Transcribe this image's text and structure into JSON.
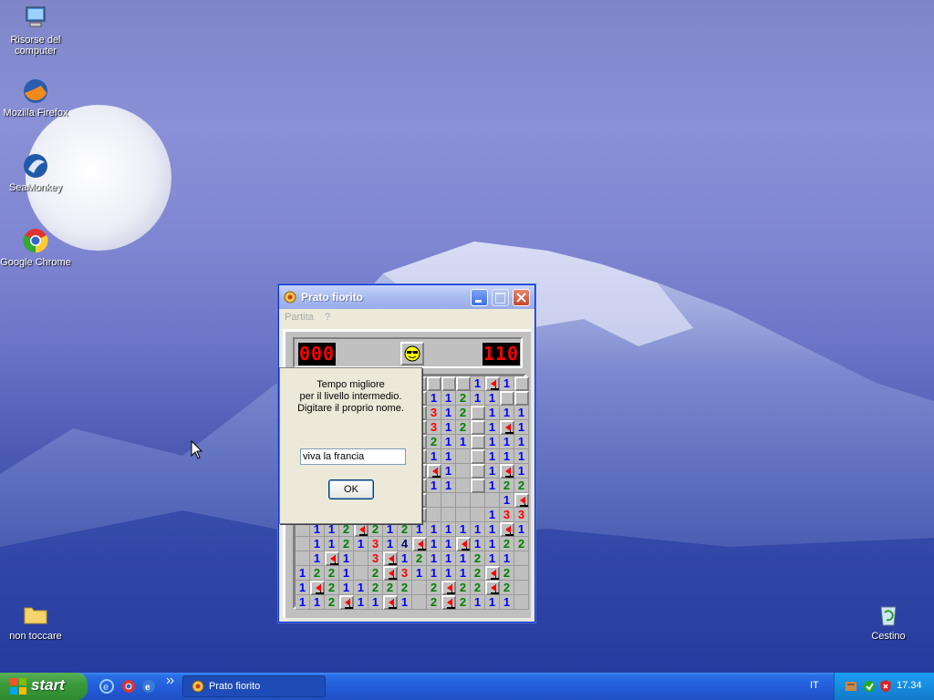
{
  "desktop": {
    "icons": [
      {
        "label_l1": "Risorse del",
        "label_l2": "computer"
      },
      {
        "label": "Mozilla Firefox"
      },
      {
        "label": "SeaMonkey"
      },
      {
        "label": "Google Chrome"
      },
      {
        "label": "non toccare"
      },
      {
        "label": "Cestino"
      }
    ]
  },
  "window": {
    "title": "Prato fiorito",
    "menu": [
      "Partita",
      "?"
    ],
    "mine_counter": "000",
    "timer": "110"
  },
  "dialog": {
    "line1": "Tempo migliore",
    "line2": "per il livello intermedio.",
    "line3": "Digitare il proprio nome.",
    "name_value": "viva la francia",
    "ok_label": "OK"
  },
  "board": {
    "rows": [
      "?,?,?,?,?,?,?,?,?,?,?,?,1,F,1,?",
      "?,?,?,?,?,?,?,?,?,1,1,2,1,1,?,?",
      "?,?,?,?,?,?,?,?,?,3,1,2,?,1,1,1",
      "?,?,?,?,?,?,?,?,?,3,1,2,?,1,F,1",
      "?,?,?,?,?,?,?,?,?,2,1,1,?,1,1,1",
      "?,?,?,?,?,?,?,?,?,1,1,0,?,1,1,1",
      "?,?,?,?,?,?,?,?,?,F,1,0,?,1,F,1",
      "?,?,?,?,?,?,?,?,?,1,1,0,?,1,2,2",
      "?,?,?,?,?,?,?,?,?,0,0,0,0,0,1,F",
      "?,?,?,?,?,?,?,?,?,0,0,0,0,1,3,3",
      "0,1,1,2,F,2,1,2,1,1,1,1,1,1,F,1",
      "0,1,1,2,1,3,1,4,F,1,1,F,1,1,2,2",
      "0,1,F,1,0,3,F,1,2,1,1,1,2,1,1,0",
      "1,2,2,1,0,2,F,3,1,1,1,1,2,F,2,0",
      "1,F,2,1,1,2,2,2,0,2,F,2,2,F,2,0",
      "1,1,2,F,1,1,F,1,0,2,F,2,1,1,1,0"
    ]
  },
  "taskbar": {
    "start_label": "start",
    "task_label": "Prato fiorito",
    "lang": "IT",
    "clock": "17.34"
  },
  "colors": {
    "taskbar_blue": "#245edb",
    "start_green": "#3c9a3c",
    "led_red": "#ff0000"
  }
}
